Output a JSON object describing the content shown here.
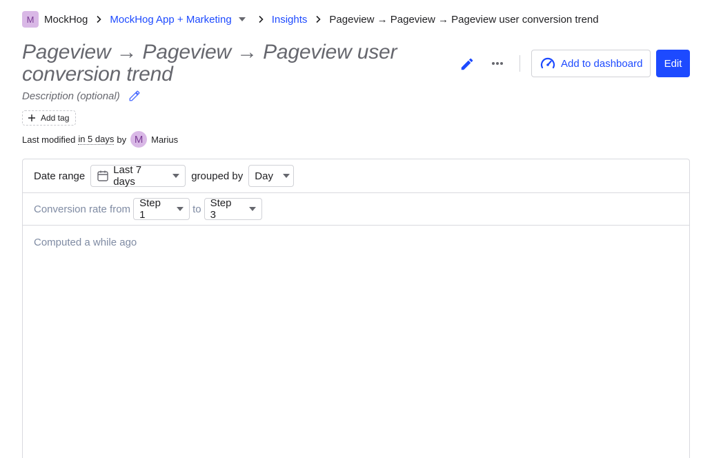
{
  "breadcrumbs": {
    "org_initial": "M",
    "org_name": "MockHog",
    "project": "MockHog App + Marketing",
    "section": "Insights",
    "current": "Pageview → Pageview → Pageview user conversion trend"
  },
  "insight": {
    "title": "Pageview → Pageview → Pageview user conversion trend",
    "description_placeholder": "Description (optional)",
    "add_tag_label": "Add tag",
    "modified_prefix": "Last modified",
    "modified_when": "in 5 days",
    "modified_by": "by",
    "user_initial": "M",
    "user_name": "Marius"
  },
  "actions": {
    "add_to_dashboard": "Add to dashboard",
    "edit": "Edit"
  },
  "filters": {
    "date_range_label": "Date range",
    "date_range_value": "Last 7 days",
    "grouped_by_label": "grouped by",
    "interval_value": "Day",
    "conversion_label": "Conversion rate from",
    "from_step": "Step 1",
    "to_label": "to",
    "to_step": "Step 3"
  },
  "status": {
    "computed": "Computed a while ago"
  },
  "colors": {
    "accent": "#1d4aff",
    "muted_text": "#66676e",
    "avatar_bg": "#d9b8e6"
  }
}
